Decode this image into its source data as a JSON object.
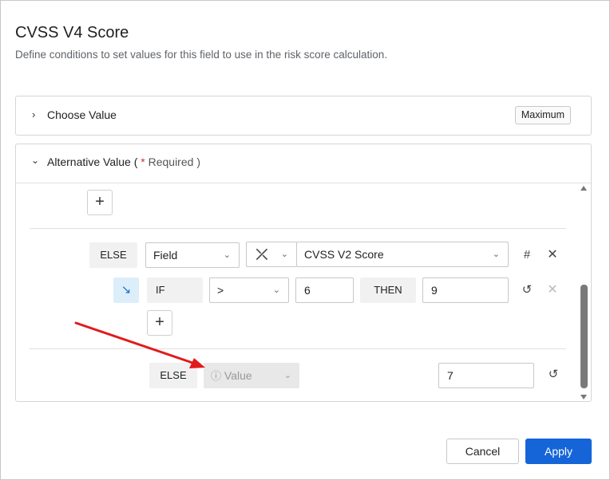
{
  "dialog": {
    "title": "CVSS V4 Score",
    "subtitle": "Define conditions to set values for this field to use in the risk score calculation."
  },
  "choose_value": {
    "label": "Choose Value",
    "badge": "Maximum",
    "chevron": "chevron-right-icon"
  },
  "alternative_value": {
    "label": "Alternative Value (",
    "required_star": "*",
    "required_text": "Required",
    "label_close": ")",
    "chevron": "chevron-down-icon"
  },
  "rule": {
    "add_label": "+",
    "else_label": "ELSE",
    "field_select": "Field",
    "function_icon": "x-cross-function-icon",
    "field_value": "CVSS V2 Score",
    "calc_icon": "hash-edit-icon",
    "close_icon": "close-icon",
    "nested": {
      "arrow_icon": "arrow-down-right-icon",
      "if_label": "IF",
      "operator": ">",
      "compare_value": "6",
      "then_label": "THEN",
      "then_value": "9",
      "history_icon": "history-icon",
      "close_icon": "close-icon"
    },
    "nested_add_label": "+"
  },
  "else_row": {
    "else_label": "ELSE",
    "value_select": "Value",
    "value_icon": "info-icon",
    "value_input": "7",
    "history_icon": "history-icon"
  },
  "footer": {
    "cancel_label": "Cancel",
    "apply_label": "Apply"
  },
  "colors": {
    "primary": "#1565d8",
    "required": "#d32f2f",
    "annotation_arrow": "#e11b1b"
  }
}
